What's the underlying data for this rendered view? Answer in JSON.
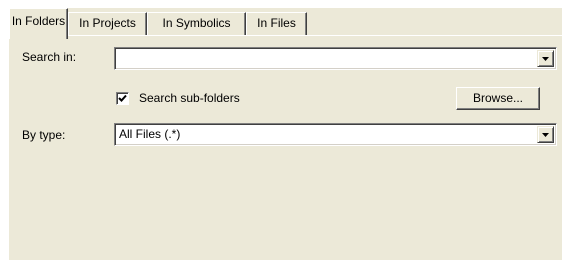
{
  "tabs": [
    {
      "label": "In Folders",
      "active": true
    },
    {
      "label": "In Projects",
      "active": false
    },
    {
      "label": "In Symbolics",
      "active": false
    },
    {
      "label": "In Files",
      "active": false
    }
  ],
  "search_in": {
    "label": "Search in:",
    "value": ""
  },
  "search_subfolders": {
    "label": "Search sub-folders",
    "checked": true
  },
  "browse_button": {
    "label": "Browse..."
  },
  "by_type": {
    "label": "By type:",
    "value": "All Files (.*)"
  },
  "icons": {
    "dropdown": "chevron-down-icon",
    "check": "checkmark-icon"
  }
}
